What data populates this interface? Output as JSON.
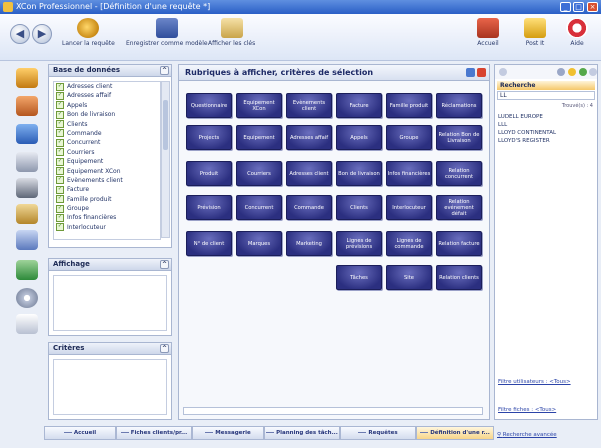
{
  "window": {
    "title": "XCon Professionnel - [Définition d'une requête *]",
    "minimize_glyph": "_",
    "maximize_glyph": "□",
    "close_glyph": "×"
  },
  "toolbar": {
    "back_glyph": "◀",
    "forward_glyph": "▶",
    "buttons_left": [
      {
        "label": "Lancer la requête",
        "icon": "search-icon"
      },
      {
        "label": "Enregistrer comme modèle",
        "icon": "save-icon"
      },
      {
        "label": "Afficher les clés",
        "icon": "keys-icon"
      }
    ],
    "buttons_right": [
      {
        "label": "Accueil",
        "icon": "home-icon"
      },
      {
        "label": "Post It",
        "icon": "post-it-icon"
      },
      {
        "label": "Aide",
        "icon": "help-icon"
      }
    ]
  },
  "panels": {
    "database": {
      "title": "Base de données",
      "items": [
        "Adresses client",
        "Adresses affaif",
        "Appels",
        "Bon de livraison",
        "Clients",
        "Commande",
        "Concurrent",
        "Courriers",
        "Equipement",
        "Equipement XCon",
        "Evènements client",
        "Facture",
        "Famille produit",
        "Groupe",
        "Infos financières",
        "Interlocuteur"
      ]
    },
    "display": {
      "title": "Affichage"
    },
    "criteria": {
      "title": "Critères"
    }
  },
  "main": {
    "title": "Rubriques à afficher, critères de sélection",
    "rubriques": [
      [
        "Questionnaire",
        "Equipement XCon",
        "Evènements client",
        "Facture",
        "Famille produit",
        "Réclamations"
      ],
      [
        "Projects",
        "Equipement",
        "Adresses affaif",
        "Appels",
        "Groupe",
        "Relation Bon de Livraison"
      ],
      [
        "Produit",
        "Courriers",
        "Adresses client",
        "Bon de livraison",
        "Infos financières",
        "Relation concurrent"
      ],
      [
        "Prévision",
        "Concurrent",
        "Commande",
        "Clients",
        "Interlocuteur",
        "Relation evénement défait"
      ],
      [
        "N° de client",
        "Marques",
        "Marketing",
        "Lignes de prévisions",
        "Lignes de commande",
        "Relation facture"
      ],
      [
        "",
        "",
        "",
        "Tâches",
        "Site",
        "Relation clients"
      ]
    ]
  },
  "right": {
    "header": "Recherche",
    "input_value": "LL",
    "count": "Trouvé(s) : 4",
    "results": [
      "LUDELL EUROPE",
      "LLL",
      "LLOYD CONTINENTAL",
      "LLOYD'S REGISTER"
    ],
    "link_users": "Filtre utilisateurs : <Tous>",
    "link_files": "Filtre fiches : <Tous>",
    "link_advanced": "Recherche avancée"
  },
  "bottom_tabs": [
    "Accueil",
    "Fiches clients/pr...",
    "Messagerie",
    "Planning des tâch...",
    "Requêtes",
    "Définition d'une r..."
  ],
  "colors": {
    "rubrique_bg": "#2b2f80",
    "titlebar": "#2a5fc6",
    "search_header": "#f5c86a"
  }
}
